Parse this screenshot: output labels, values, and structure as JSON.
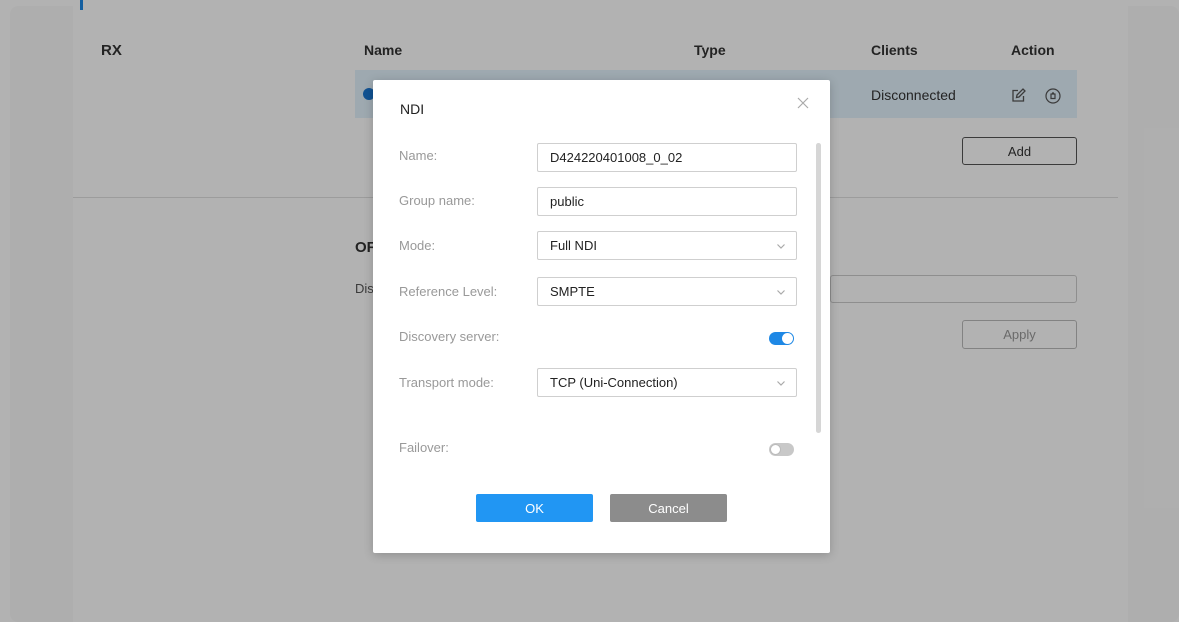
{
  "background": {
    "rx_label": "RX",
    "table": {
      "headers": {
        "name": "Name",
        "type": "Type",
        "clients": "Clients",
        "action": "Action"
      },
      "row": {
        "clients": "Disconnected",
        "edit_icon": "edit-icon",
        "delete_icon": "delete-icon"
      }
    },
    "add_label": "Add",
    "section_title_partial": "OF",
    "section_label_partial": "Dis",
    "apply_label": "Apply"
  },
  "modal": {
    "title": "NDI",
    "close_icon": "close-icon",
    "fields": {
      "name": {
        "label": "Name:",
        "value": "D424220401008_0_02"
      },
      "group_name": {
        "label": "Group name:",
        "value": "public"
      },
      "mode": {
        "label": "Mode:",
        "value": "Full NDI"
      },
      "reference_level": {
        "label": "Reference Level:",
        "value": "SMPTE"
      },
      "discovery_server": {
        "label": "Discovery server:",
        "enabled": true
      },
      "transport_mode": {
        "label": "Transport mode:",
        "value": "TCP (Uni-Connection)"
      },
      "failover": {
        "label": "Failover:",
        "enabled": false
      }
    },
    "ok_label": "OK",
    "cancel_label": "Cancel"
  },
  "colors": {
    "accent": "#2196f3",
    "toggle_on": "#1e88e5",
    "cancel": "#8c8c8c",
    "row_highlight": "#e3f2fd"
  }
}
